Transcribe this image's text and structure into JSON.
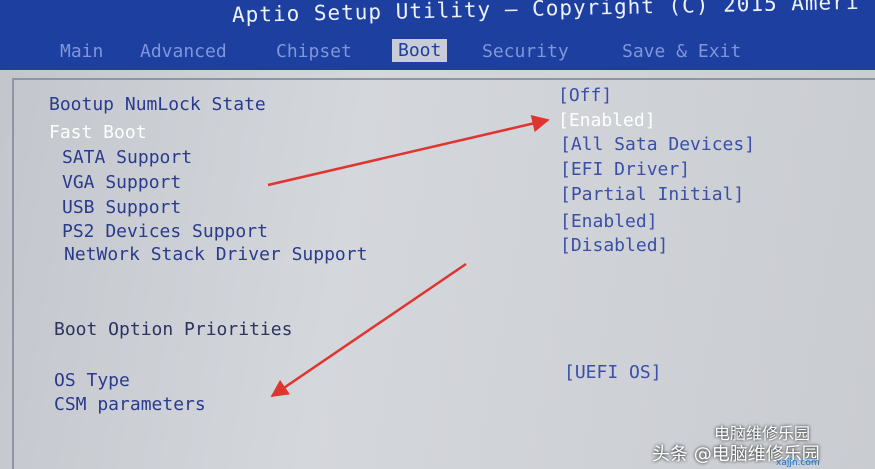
{
  "window": {
    "title": "Aptio Setup Utility – Copyright (C) 2015 Ameri"
  },
  "tabs": [
    {
      "label": "Main"
    },
    {
      "label": "Advanced"
    },
    {
      "label": "Chipset"
    },
    {
      "label": "Boot",
      "active": true
    },
    {
      "label": "Security"
    },
    {
      "label": "Save & Exit"
    }
  ],
  "settings": [
    {
      "label": "Bootup NumLock State",
      "value": "[Off]"
    },
    {
      "label": "Fast Boot",
      "value": "[Enabled]",
      "selected": true
    },
    {
      "label": "SATA Support",
      "value": "[All Sata Devices]"
    },
    {
      "label": "VGA Support",
      "value": "[EFI Driver]"
    },
    {
      "label": "USB Support",
      "value": "[Partial Initial]"
    },
    {
      "label": "PS2 Devices Support",
      "value": "[Enabled]"
    },
    {
      "label": "NetWork Stack Driver Support",
      "value": "[Disabled]"
    }
  ],
  "boot_option_heading": "Boot Option Priorities",
  "os_type": {
    "label": "OS Type",
    "value": "[UEFI OS]"
  },
  "csm": {
    "label": "CSM parameters"
  },
  "watermark": {
    "line1": "电脑维修乐园",
    "line2": "头条 @电脑维修乐园",
    "url": "xajjn.com"
  },
  "colors": {
    "title_bar": "#1c3fa0",
    "screen_bg": "#cdd0d5",
    "arrow": "#e0342f",
    "label_text": "#2a3a8c",
    "highlight": "#ffffff"
  }
}
